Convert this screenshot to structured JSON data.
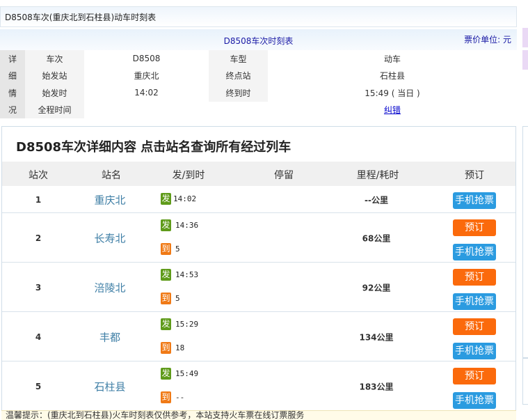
{
  "page_title": "D8508车次(重庆北到石柱县)动车时刻表",
  "info": {
    "header": "D8508车次时刻表",
    "price_unit": "票价单位: 元",
    "side_chars": [
      "详",
      "细",
      "情",
      "况"
    ],
    "rows": [
      {
        "l1": "车次",
        "v1": "D8508",
        "l2": "车型",
        "v2": "动车"
      },
      {
        "l1": "始发站",
        "v1": "重庆北",
        "l2": "终点站",
        "v2": "石柱县"
      },
      {
        "l1": "始发时",
        "v1": "14:02",
        "l2": "终到时",
        "v2": "15:49 ( 当日 )"
      },
      {
        "l1": "全程时间",
        "v1": "",
        "l2": "",
        "v2": "纠错"
      }
    ]
  },
  "detail": {
    "title": "D8508车次详细内容 点击站名查询所有经过列车",
    "headers": [
      "站次",
      "站名",
      "发/到时",
      "停留",
      "里程/耗时",
      "预订"
    ],
    "depart_tag": "发",
    "arrive_tag": "到",
    "book_label": "预订",
    "mobile_label": "手机抢票",
    "stops": [
      {
        "no": "1",
        "name": "重庆北",
        "depart": "14:02",
        "arrive": null,
        "km": "--公里"
      },
      {
        "no": "2",
        "name": "长寿北",
        "depart": "14:36",
        "arrive": "5",
        "km": "68公里"
      },
      {
        "no": "3",
        "name": "涪陵北",
        "depart": "14:53",
        "arrive": "5",
        "km": "92公里"
      },
      {
        "no": "4",
        "name": "丰都",
        "depart": "15:29",
        "arrive": "18",
        "km": "134公里"
      },
      {
        "no": "5",
        "name": "石柱县",
        "depart": "15:49",
        "arrive": "--",
        "km": "183公里"
      }
    ]
  },
  "note": "温馨提示：(重庆北到石柱县)火车时刻表仅供参考，本站支持火车票在线订票服务"
}
